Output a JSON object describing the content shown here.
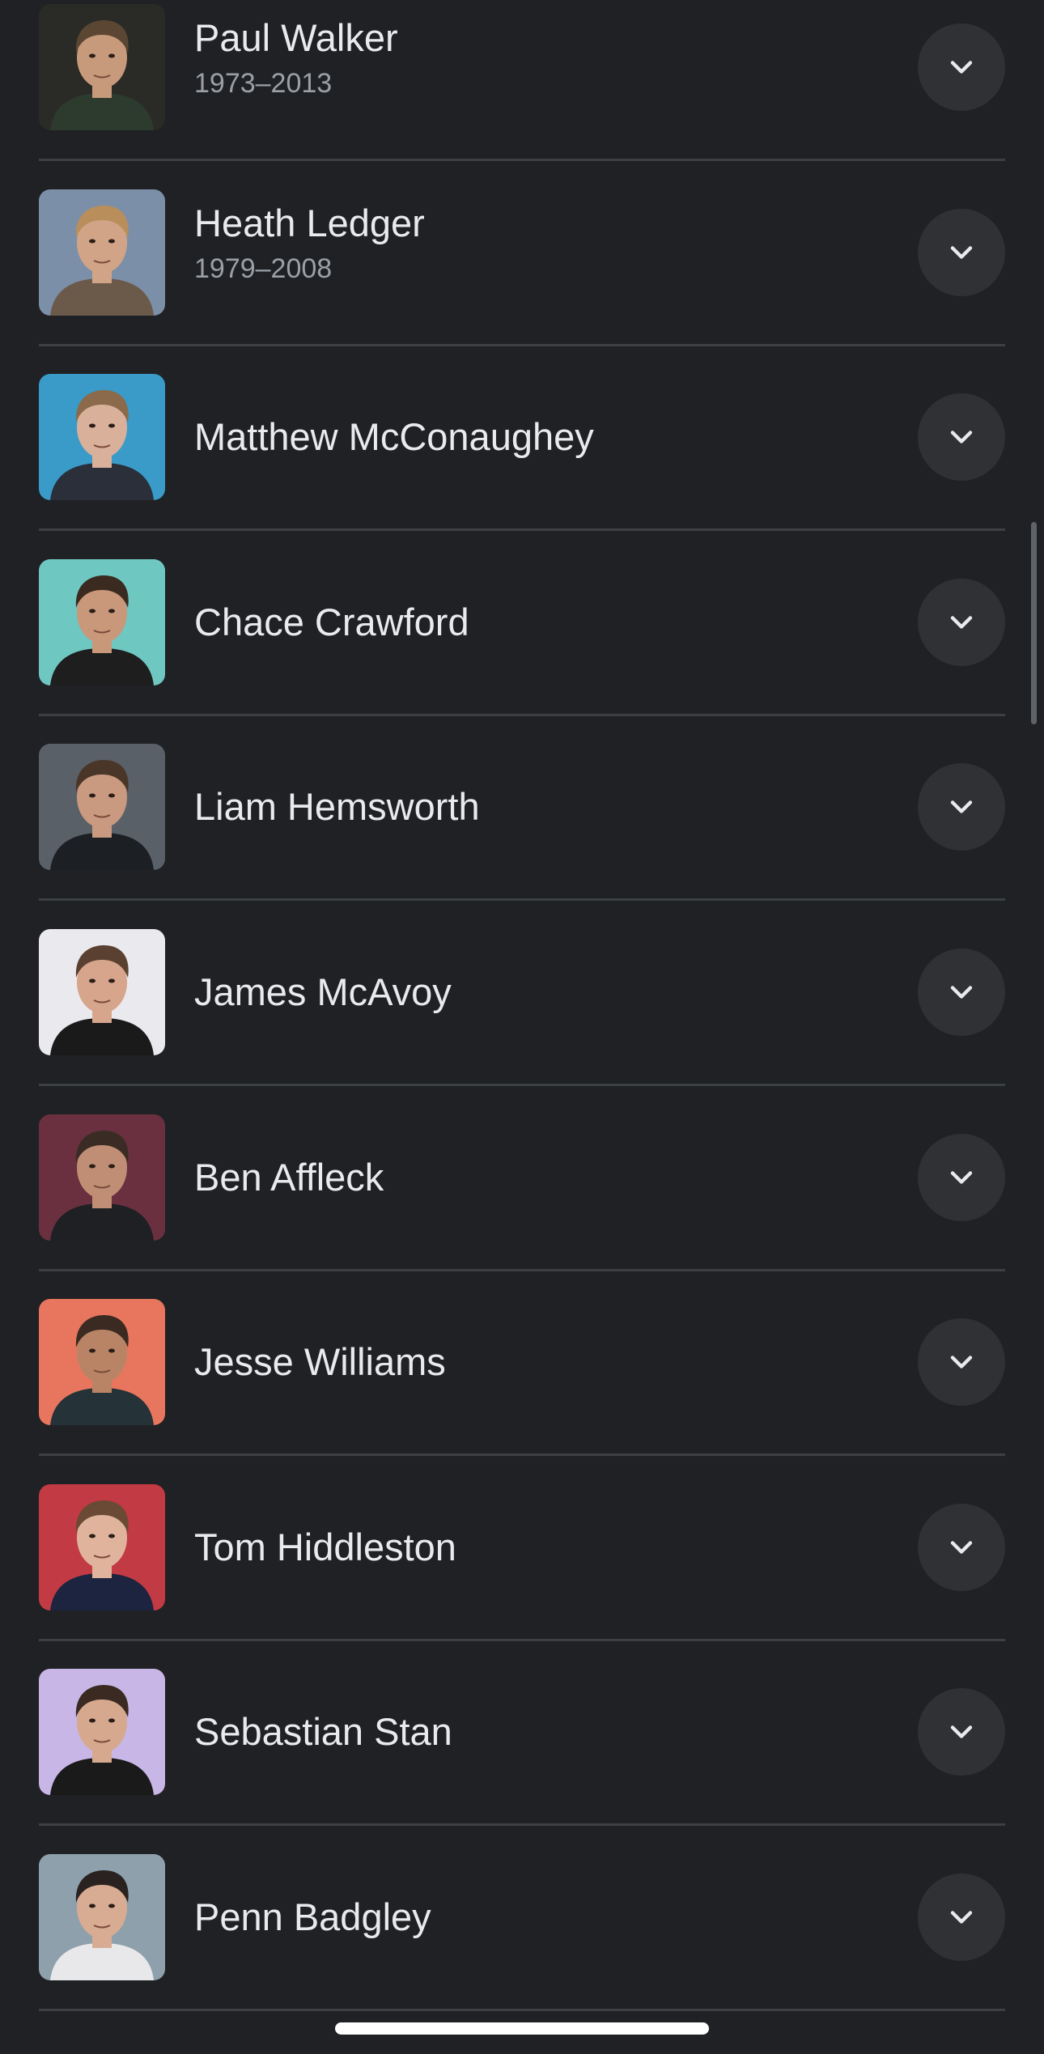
{
  "people": [
    {
      "name": "Paul Walker",
      "years": "1973–2013",
      "photo": "portrait-photo",
      "bg": "#2a2a26",
      "skin": "#c89a7c",
      "hair": "#5a4632",
      "shirt": "#2d3a2e"
    },
    {
      "name": "Heath Ledger",
      "years": "1979–2008",
      "photo": "portrait-photo",
      "bg": "#7c8fa8",
      "skin": "#d2a487",
      "hair": "#b98e5a",
      "shirt": "#6b5a4a"
    },
    {
      "name": "Matthew McConaughey",
      "years": "",
      "photo": "portrait-photo",
      "bg": "#3a9ac8",
      "skin": "#d9b19a",
      "hair": "#8a6a4a",
      "shirt": "#2a2f3a"
    },
    {
      "name": "Chace Crawford",
      "years": "",
      "photo": "portrait-photo",
      "bg": "#6fc7c2",
      "skin": "#c9977a",
      "hair": "#3a2a20",
      "shirt": "#1e1e1e"
    },
    {
      "name": "Liam Hemsworth",
      "years": "",
      "photo": "portrait-photo",
      "bg": "#5a6068",
      "skin": "#c99a80",
      "hair": "#4a3628",
      "shirt": "#1c1f24"
    },
    {
      "name": "James McAvoy",
      "years": "",
      "photo": "portrait-photo",
      "bg": "#e9e9ee",
      "skin": "#d6a58c",
      "hair": "#5a4030",
      "shirt": "#1a1a1a"
    },
    {
      "name": "Ben Affleck",
      "years": "",
      "photo": "portrait-photo",
      "bg": "#6a3040",
      "skin": "#c08e74",
      "hair": "#3a2c24",
      "shirt": "#1e2024"
    },
    {
      "name": "Jesse Williams",
      "years": "",
      "photo": "portrait-photo",
      "bg": "#e8765e",
      "skin": "#b98466",
      "hair": "#3a2a22",
      "shirt": "#253238"
    },
    {
      "name": "Tom Hiddleston",
      "years": "",
      "photo": "portrait-photo",
      "bg": "#c23a44",
      "skin": "#e0b49c",
      "hair": "#6a4a34",
      "shirt": "#1c2440"
    },
    {
      "name": "Sebastian Stan",
      "years": "",
      "photo": "portrait-photo",
      "bg": "#c8b6e6",
      "skin": "#d6a88e",
      "hair": "#3a2a22",
      "shirt": "#1a1a1a"
    },
    {
      "name": "Penn Badgley",
      "years": "",
      "photo": "portrait-photo",
      "bg": "#8ea0ac",
      "skin": "#d8ac92",
      "hair": "#2a2220",
      "shirt": "#e8e8ea"
    }
  ],
  "expand_icon": "chevron-down-icon",
  "colors": {
    "background": "#202124",
    "text_primary": "#e8eaed",
    "text_secondary": "#9aa0a6",
    "divider": "#3c4043",
    "button_bg": "#303134"
  }
}
